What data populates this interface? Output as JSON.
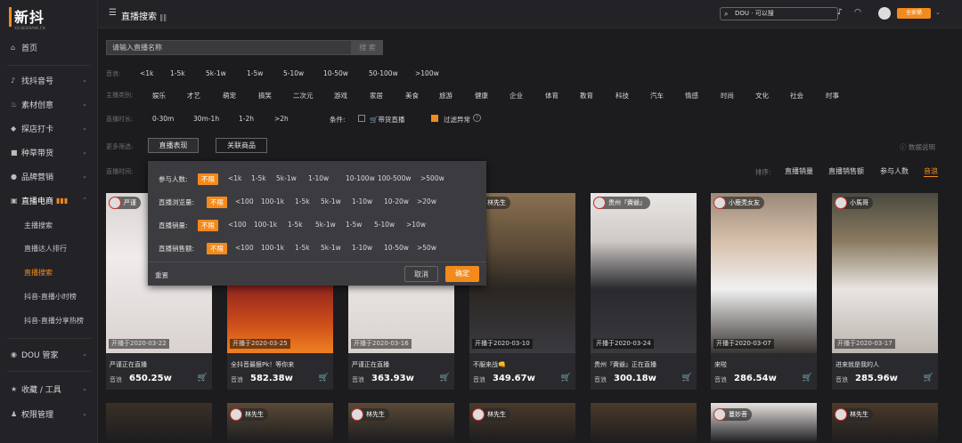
{
  "app": {
    "logo_text": "新抖",
    "logo_sub": "XD.NEWRANK.CN",
    "page_title": "直播搜索"
  },
  "topbar": {
    "search_text": "DOU · 可以搜",
    "btn_label": "全家桶",
    "dropdown": "⌄"
  },
  "sidebar": {
    "items": [
      {
        "label": "首页",
        "icon": "home-icon"
      },
      {
        "label": "找抖音号",
        "icon": "tiktok-icon"
      },
      {
        "label": "素材创意",
        "icon": "fire-icon"
      },
      {
        "label": "探店打卡",
        "icon": "map-pin-icon"
      },
      {
        "label": "种草带货",
        "icon": "shop-icon"
      },
      {
        "label": "品牌营销",
        "icon": "brand-icon"
      },
      {
        "label": "直播电商",
        "icon": "live-icon"
      },
      {
        "label": "DOU 管家",
        "icon": "dou-icon"
      },
      {
        "label": "收藏 / 工具",
        "icon": "star-icon"
      },
      {
        "label": "权限管理",
        "icon": "user-icon"
      }
    ],
    "subitems": [
      "主播搜索",
      "直播达人排行",
      "直播搜索",
      "抖音-直播小时榜",
      "抖音-直播分享热榜"
    ],
    "active_sub": "直播搜索"
  },
  "search": {
    "placeholder": "请输入直播名称",
    "button": "搜 索"
  },
  "filters": {
    "row1": {
      "label": "音浪:",
      "options": [
        "<1k",
        "1-5k",
        "5k-1w",
        "1-5w",
        "5-10w",
        "10-50w",
        "50-100w",
        ">100w"
      ]
    },
    "row2": {
      "label": "主播类别:",
      "options": [
        "娱乐",
        "才艺",
        "萌宠",
        "搞笑",
        "二次元",
        "游戏",
        "家居",
        "美食",
        "旅游",
        "健康",
        "企业",
        "体育",
        "教育",
        "科技",
        "汽车",
        "情感",
        "时尚",
        "文化",
        "社会",
        "时事"
      ]
    },
    "row3": {
      "label": "直播时长:",
      "options": [
        "0-30m",
        "30m-1h",
        "1-2h",
        ">2h"
      ],
      "cond_label": "条件:",
      "cond1": "带货直播",
      "cond2": "过滤异常",
      "cond2_hint": "?"
    },
    "row4": {
      "label": "更多筛选:",
      "btn1": "直播表现",
      "btn2": "关联商品",
      "data_note": "数据说明"
    },
    "row5": {
      "label": "直播时间:",
      "sort_label": "排序:",
      "sorts": [
        "直播销量",
        "直播销售额",
        "参与人数",
        "音浪"
      ],
      "active_sort": "音浪"
    }
  },
  "popup": {
    "rows": [
      {
        "label": "参与人数:",
        "options": [
          "不限",
          "<1k",
          "1-5k",
          "5k-1w",
          "1-10w",
          "10-100w",
          "100-500w",
          ">500w"
        ]
      },
      {
        "label": "直播浏览量:",
        "options": [
          "不限",
          "<100",
          "100-1k",
          "1-5k",
          "5k-1w",
          "1-10w",
          "10-20w",
          ">20w"
        ]
      },
      {
        "label": "直播销量:",
        "options": [
          "不限",
          "<100",
          "100-1k",
          "1-5k",
          "5k-1w",
          "1-5w",
          "5-10w",
          ">10w"
        ]
      },
      {
        "label": "直播销售额:",
        "options": [
          "不限",
          "<100",
          "100-1k",
          "1-5k",
          "5k-1w",
          "1-10w",
          "10-50w",
          ">50w"
        ]
      }
    ],
    "reset": "重置",
    "cancel": "取消",
    "confirm": "确定"
  },
  "cards": [
    {
      "host": "严谨",
      "date": "开播于2020-03-22",
      "caption": "严谨正在直播",
      "label": "音浪",
      "value": "650.25w"
    },
    {
      "host": "",
      "date": "开播于2020-03-25",
      "caption": "全抖音最狠Pk！等你来",
      "label": "音浪",
      "value": "582.38w"
    },
    {
      "host": "",
      "date": "开播于2020-03-16",
      "caption": "严谨正在直播",
      "label": "音浪",
      "value": "363.93w"
    },
    {
      "host": "林先生",
      "date": "开播于2020-03-10",
      "caption": "不服来战👊",
      "label": "音浪",
      "value": "349.67w"
    },
    {
      "host": "贵州『賫爺』",
      "date": "开播于2020-03-24",
      "caption": "贵州『賫爺』正在直播",
      "label": "音浪",
      "value": "300.18w"
    },
    {
      "host": "小鹿秃女友",
      "date": "开播于2020-03-07",
      "caption": "来啦",
      "label": "音浪",
      "value": "286.54w"
    },
    {
      "host": "小馬哥",
      "date": "开播于2020-03-17",
      "caption": "进来就是我的人",
      "label": "音浪",
      "value": "285.96w"
    }
  ],
  "cards2": [
    {
      "host": ""
    },
    {
      "host": "林先生"
    },
    {
      "host": "林先生"
    },
    {
      "host": "林先生"
    },
    {
      "host": ""
    },
    {
      "host": "蔓妙菩"
    },
    {
      "host": "林先生"
    }
  ],
  "colors": {
    "accent": "#f38a1c",
    "bg": "#1c1c1f",
    "panel": "#232327"
  }
}
